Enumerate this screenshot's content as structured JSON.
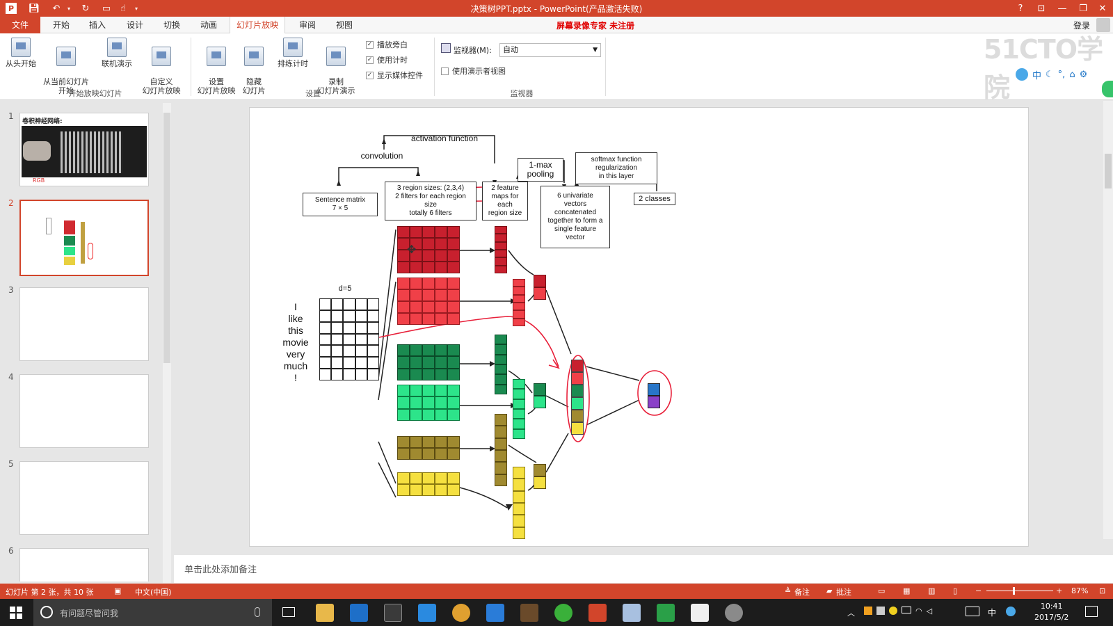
{
  "titlebar": {
    "title": "决策树PPT.pptx - PowerPoint(产品激活失败)",
    "help": "?",
    "ribbon_display": "⊡",
    "minimize": "—",
    "restore": "❐",
    "close": "✕"
  },
  "tabs": {
    "file": "文件",
    "items": [
      "开始",
      "插入",
      "设计",
      "切换",
      "动画",
      "幻灯片放映",
      "审阅",
      "视图"
    ],
    "active": "幻灯片放映"
  },
  "watermark_text": "屏幕录像专家  未注册",
  "login": "登录",
  "ribbon": {
    "buttons": {
      "from_start": "从头开始",
      "from_current": "从当前幻灯片\n开始",
      "online": "联机演示",
      "custom": "自定义\n幻灯片放映",
      "setup": "设置\n幻灯片放映",
      "hide": "隐藏\n幻灯片",
      "rehearse": "排练计时",
      "record": "录制\n幻灯片演示"
    },
    "checkboxes": {
      "narration": "播放旁白",
      "timing": "使用计时",
      "media": "显示媒体控件",
      "presenter_view": "使用演示者视图"
    },
    "monitor_label": "监视器(M):",
    "monitor_value": "自动",
    "groups": {
      "start": "开始放映幻灯片",
      "setup": "设置",
      "monitor": "监视器"
    }
  },
  "logo": "51CTO学院",
  "ime": {
    "mode": "中"
  },
  "thumbnails": {
    "numbers": [
      "1",
      "2",
      "3",
      "4",
      "5",
      "6"
    ],
    "slide1_title": "卷积神经网络:",
    "slide1_note": "RGB"
  },
  "diagram": {
    "activation": "activation function",
    "convolution": "convolution",
    "pooling": "1-max\npooling",
    "softmax": "softmax function\nregularization\nin this layer",
    "sentence_matrix": "Sentence matrix\n7 × 5",
    "region_sizes": "3 region sizes: (2,3,4)\n2 filters for each region\nsize\ntotally 6 filters",
    "feature_maps": "2 feature\nmaps for\neach\nregion size",
    "univariate": "6 univariate\nvectors\nconcatenated\ntogether to form a\nsingle feature\nvector",
    "classes": "2 classes",
    "d_label": "d=5",
    "words": [
      "I",
      "like",
      "this",
      "movie",
      "very",
      "much",
      "!"
    ],
    "colors": {
      "dark_red": "#c8202e",
      "red": "#f04048",
      "dark_green": "#1a8a50",
      "green": "#2de48a",
      "olive": "#a08a30",
      "yellow": "#f5e040",
      "blue": "#2876c8",
      "purple": "#8a40c8",
      "annotation_red": "#e8203a"
    }
  },
  "notes_placeholder": "单击此处添加备注",
  "status": {
    "slide_info": "幻灯片 第 2 张，共 10 张",
    "language": "中文(中国)",
    "notes": "备注",
    "comments": "批注",
    "zoom": "87%"
  },
  "taskbar": {
    "search_placeholder": "有问题尽管问我",
    "time": "10:41",
    "date": "2017/5/2",
    "ime": "中"
  }
}
